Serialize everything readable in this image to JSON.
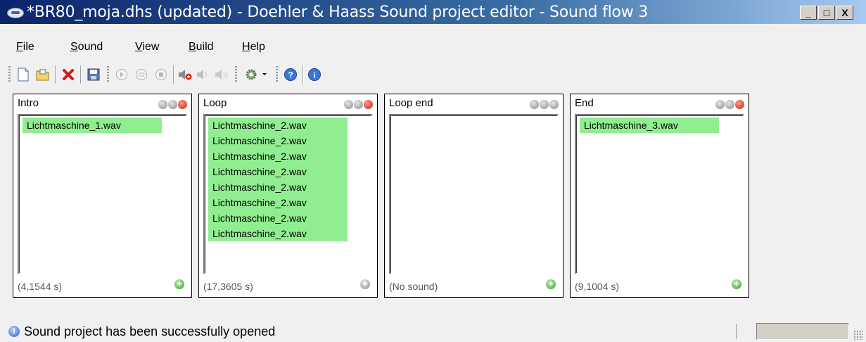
{
  "window": {
    "title": "*BR80_moja.dhs (updated) - Doehler & Haass Sound project editor - Sound flow 3",
    "buttons": {
      "minimize": "_",
      "maximize": "□",
      "close": "X"
    }
  },
  "menu": [
    {
      "label": "File",
      "mnemonic": "F",
      "rest": "ile"
    },
    {
      "label": "Sound",
      "mnemonic": "S",
      "rest": "ound"
    },
    {
      "label": "View",
      "mnemonic": "V",
      "rest": "iew"
    },
    {
      "label": "Build",
      "mnemonic": "B",
      "rest": "uild"
    },
    {
      "label": "Help",
      "mnemonic": "H",
      "rest": "elp"
    }
  ],
  "toolbar": {
    "icons": [
      "new-file-icon",
      "open-folder-icon",
      "delete-icon",
      "save-icon",
      "play-icon",
      "loop-icon",
      "stop-icon",
      "speaker-add-icon",
      "speaker-icon",
      "speaker-low-icon",
      "settings-icon",
      "help-icon",
      "info-icon"
    ]
  },
  "panels": [
    {
      "title": "Intro",
      "items": [
        "Lichtmaschine_1.wav"
      ],
      "duration": "(4,1544 s)",
      "add_enabled": true
    },
    {
      "title": "Loop",
      "items": [
        "Lichtmaschine_2.wav",
        "Lichtmaschine_2.wav",
        "Lichtmaschine_2.wav",
        "Lichtmaschine_2.wav",
        "Lichtmaschine_2.wav",
        "Lichtmaschine_2.wav",
        "Lichtmaschine_2.wav",
        "Lichtmaschine_2.wav"
      ],
      "duration": "(17,3605 s)",
      "add_enabled": false
    },
    {
      "title": "Loop end",
      "items": [],
      "duration": "(No sound)",
      "add_enabled": true
    },
    {
      "title": "End",
      "items": [
        "Lichtmaschine_3.wav"
      ],
      "duration": "(9,1004 s)",
      "add_enabled": true
    }
  ],
  "status": {
    "message": "Sound project has been successfully opened",
    "icon": "info-icon"
  },
  "colors": {
    "list_item_bg": "#90ee90",
    "title_gradient_start": "#0a246a",
    "title_gradient_end": "#a6caf0"
  }
}
